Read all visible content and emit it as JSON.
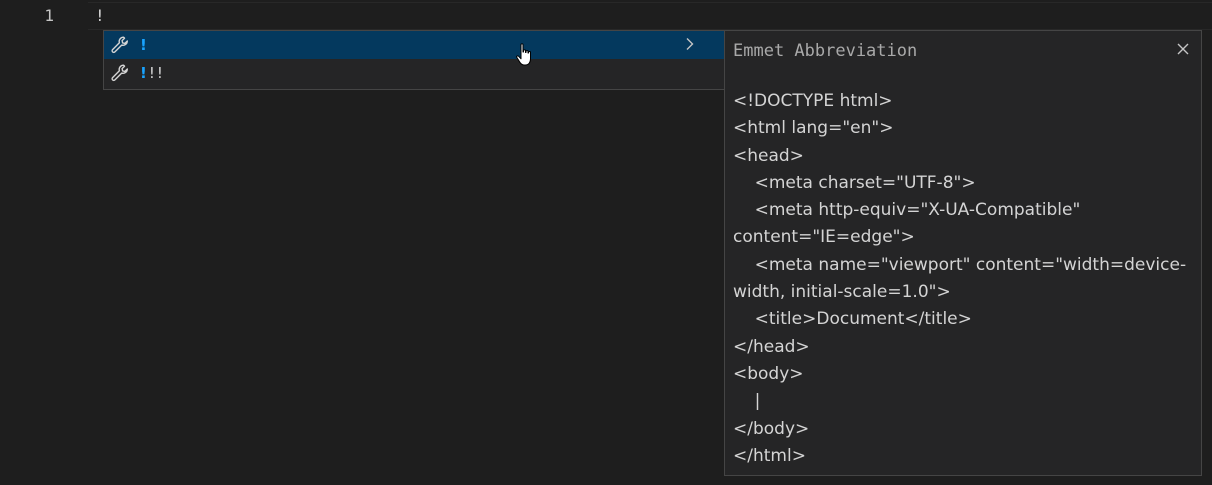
{
  "editor": {
    "line_number": "1",
    "line_text": "!"
  },
  "suggestions": [
    {
      "label_highlight": "!",
      "label_rest": "",
      "icon": "wrench-icon",
      "selected": true
    },
    {
      "label_highlight": "!",
      "label_rest": "!!",
      "icon": "wrench-icon",
      "selected": false
    }
  ],
  "details": {
    "title": "Emmet Abbreviation",
    "code": "<!DOCTYPE html>\n<html lang=\"en\">\n<head>\n\t<meta charset=\"UTF-8\">\n\t<meta http-equiv=\"X-UA-Compatible\" content=\"IE=edge\">\n\t<meta name=\"viewport\" content=\"width=device-width, initial-scale=1.0\">\n\t<title>Document</title>\n</head>\n<body>\n\t|\n</body>\n</html>"
  },
  "colors": {
    "background": "#1e1e1e",
    "widget_background": "#252526",
    "selected_background": "#04395e",
    "match_highlight": "#18a3ff",
    "border": "#454545"
  }
}
